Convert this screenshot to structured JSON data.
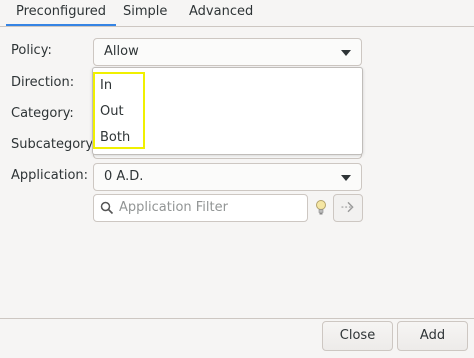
{
  "tabs": [
    {
      "label": "Preconfigured",
      "active": true
    },
    {
      "label": "Simple",
      "active": false
    },
    {
      "label": "Advanced",
      "active": false
    }
  ],
  "form": {
    "policy_label": "Policy:",
    "policy_value": "Allow",
    "direction_label": "Direction:",
    "category_label": "Category:",
    "subcategory_label": "Subcategory:",
    "application_label": "Application:",
    "application_value": "0 A.D.",
    "filter_placeholder": "Application Filter"
  },
  "direction_dropdown": {
    "options": [
      "In",
      "Out",
      "Both"
    ]
  },
  "buttons": {
    "close": "Close",
    "add": "Add"
  },
  "colors": {
    "accent": "#3584e4",
    "highlight": "#f0f000",
    "background": "#f6f5f4"
  }
}
